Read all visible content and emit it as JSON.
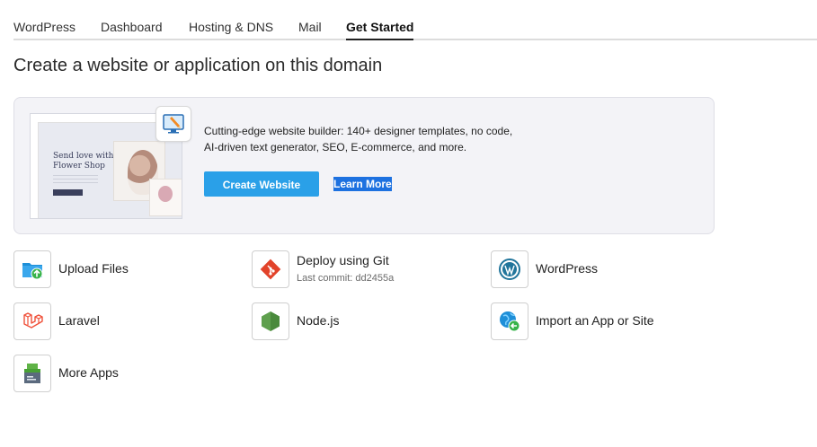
{
  "tabs": [
    {
      "label": "WordPress"
    },
    {
      "label": "Dashboard"
    },
    {
      "label": "Hosting & DNS"
    },
    {
      "label": "Mail"
    },
    {
      "label": "Get Started"
    }
  ],
  "active_tab": "Get Started",
  "page_title": "Create a website or application on this domain",
  "promo": {
    "preview": {
      "headline": "Send love with Flower Shop"
    },
    "description": "Cutting-edge website builder: 140+ designer templates, no code, AI-driven text generator, SEO, E-commerce, and more.",
    "create_label": "Create Website",
    "learn_label": "Learn More",
    "colors": {
      "create_button": "#2aa0e8",
      "learn_highlight": "#1d71e0",
      "card_bg": "#f3f3f7"
    }
  },
  "apps": [
    {
      "label": "Upload Files",
      "icon": "upload-folder-icon"
    },
    {
      "label": "Deploy using Git",
      "sublabel": "Last commit: dd2455a",
      "icon": "git-icon"
    },
    {
      "label": "WordPress",
      "icon": "wordpress-icon"
    },
    {
      "label": "Laravel",
      "icon": "laravel-icon"
    },
    {
      "label": "Node.js",
      "icon": "nodejs-icon"
    },
    {
      "label": "Import an App or Site",
      "icon": "import-globe-icon"
    },
    {
      "label": "More Apps",
      "icon": "more-apps-icon"
    }
  ]
}
